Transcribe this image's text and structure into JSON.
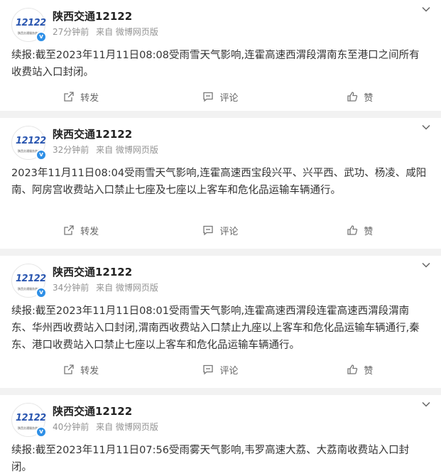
{
  "posts": [
    {
      "author": "陕西交通12122",
      "time": "27分钟前",
      "source": "来自 微博网页版",
      "text": "续报:截至2023年11月11日08:08受雨雪天气影响,连霍高速西渭段渭南东至港口之间所有收费站入口封闭。",
      "repost_label": "转发",
      "comment_label": "评论",
      "like_label": "赞"
    },
    {
      "author": "陕西交通12122",
      "time": "32分钟前",
      "source": "来自 微博网页版",
      "text": "2023年11月11日08:04受雨雪天气影响,连霍高速西宝段兴平、兴平西、武功、杨凌、咸阳南、阿房宫收费站入口禁止七座及七座以上客车和危化品运输车辆通行。",
      "repost_label": "转发",
      "comment_label": "评论",
      "like_label": "赞"
    },
    {
      "author": "陕西交通12122",
      "time": "34分钟前",
      "source": "来自 微博网页版",
      "text": "续报:截至2023年11月11日08:01受雨雪天气影响,连霍高速西渭段连霍高速西渭段渭南东、华州西收费站入口封闭,渭南西收费站入口禁止九座以上客车和危化品运输车辆通行,秦东、港口收费站入口禁止七座以上客车和危化品运输车辆通行。",
      "repost_label": "转发",
      "comment_label": "评论",
      "like_label": "赞"
    },
    {
      "author": "陕西交通12122",
      "time": "40分钟前",
      "source": "来自 微博网页版",
      "text": "续报:截至2023年11月11日07:56受雨雾天气影响,韦罗高速大荔、大荔南收费站入口封闭。",
      "repost_label": "转发",
      "comment_label": "评论",
      "like_label": "赞"
    }
  ],
  "avatar": {
    "logo_text": "12122",
    "logo_sub": "陕西交通服务热线",
    "verified_mark": "v",
    "brand_color": "#2a56b0",
    "verified_color": "#2e8fe6"
  },
  "icons": {
    "menu": "chevron-down-icon",
    "repost": "share-icon",
    "comment": "comment-icon",
    "like": "thumbs-up-icon"
  }
}
